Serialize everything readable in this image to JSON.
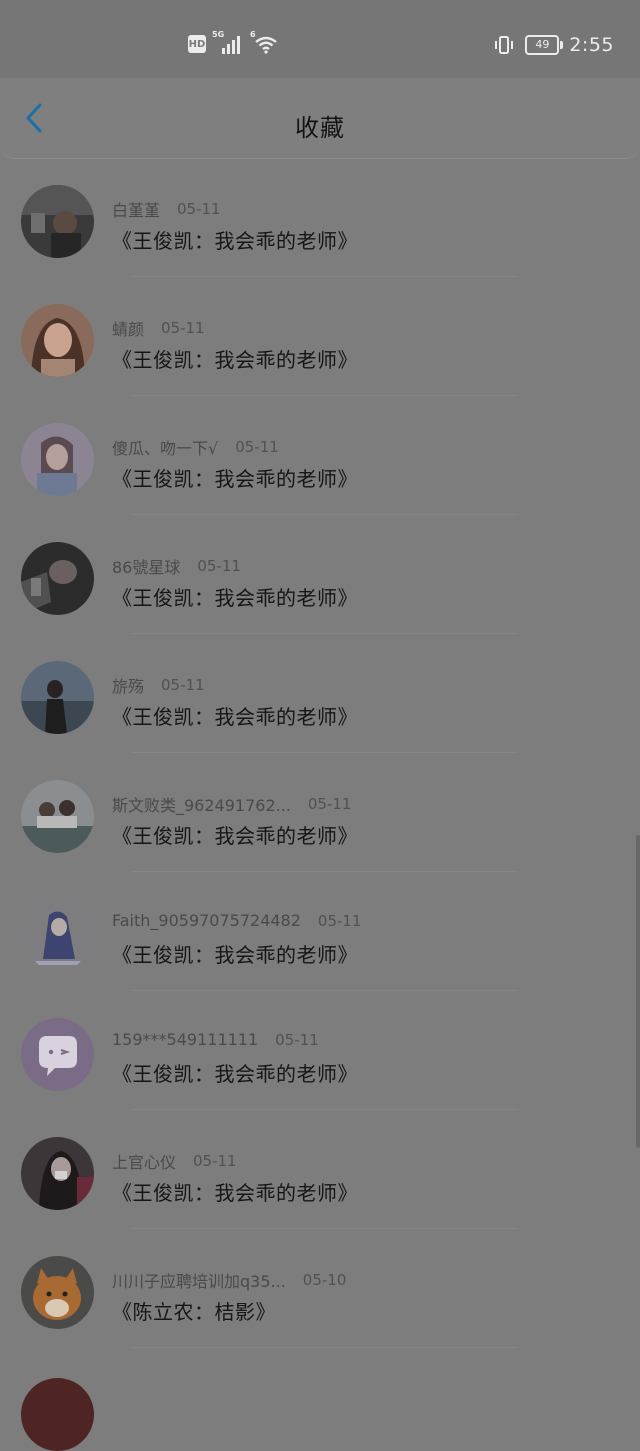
{
  "status_bar": {
    "hd": "HD",
    "signal_gen": "5G",
    "wifi_gen": "6",
    "battery": "49",
    "time": "2:55"
  },
  "header": {
    "title": "收藏"
  },
  "items": [
    {
      "username": "白堇堇",
      "date": "05-11",
      "title": "《王俊凯：我会乖的老师》",
      "avatar_color": "#3a3a3a"
    },
    {
      "username": "蜻颜",
      "date": "05-11",
      "title": "《王俊凯：我会乖的老师》",
      "avatar_color": "#8a6a5a"
    },
    {
      "username": "傻瓜、吻一下√",
      "date": "05-11",
      "title": "《王俊凯：我会乖的老师》",
      "avatar_color": "#8c8492"
    },
    {
      "username": "86號星球",
      "date": "05-11",
      "title": "《王俊凯：我会乖的老师》",
      "avatar_color": "#2c2c2c"
    },
    {
      "username": "旂殇",
      "date": "05-11",
      "title": "《王俊凯：我会乖的老师》",
      "avatar_color": "#47505a"
    },
    {
      "username": "斯文败类_962491762...",
      "date": "05-11",
      "title": "《王俊凯：我会乖的老师》",
      "avatar_color": "#6b7278"
    },
    {
      "username": "Faith_90597075724482",
      "date": "05-11",
      "title": "《王俊凯：我会乖的老师》",
      "avatar_color": "#7d7d80"
    },
    {
      "username": "159***549111111",
      "date": "05-11",
      "title": "《王俊凯：我会乖的老师》",
      "avatar_color": "#7a6b86"
    },
    {
      "username": "上官心仪",
      "date": "05-11",
      "title": "《王俊凯：我会乖的老师》",
      "avatar_color": "#3c3638"
    },
    {
      "username": "川川子应聘培训加q35...",
      "date": "05-10",
      "title": "《陈立农：桔影》",
      "avatar_color": "#7a5a3a"
    }
  ]
}
